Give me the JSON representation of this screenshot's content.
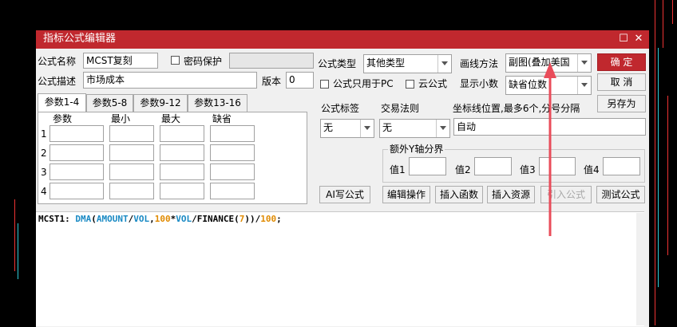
{
  "window": {
    "title": "指标公式编辑器"
  },
  "fields": {
    "name_label": "公式名称",
    "name_value": "MCST复刻",
    "password_label": "密码保护",
    "desc_label": "公式描述",
    "desc_value": "市场成本",
    "version_label": "版本",
    "version_value": "0",
    "type_label": "公式类型",
    "type_value": "其他类型",
    "pc_only_label": "公式只用于PC",
    "cloud_label": "云公式",
    "draw_label": "画线方法",
    "draw_value": "副图(叠加美国",
    "decimal_label": "显示小数",
    "decimal_value": "缺省位数"
  },
  "buttons": {
    "ok": "确 定",
    "cancel": "取 消",
    "save_as": "另存为",
    "ai": "AI写公式",
    "edit_ops": "编辑操作",
    "insert_func": "插入函数",
    "insert_resource": "插入资源",
    "import_formula": "引入公式",
    "test_formula": "测试公式"
  },
  "tabs": [
    "参数1-4",
    "参数5-8",
    "参数9-12",
    "参数13-16"
  ],
  "params": {
    "headers": [
      "参数",
      "最小",
      "最大",
      "缺省"
    ],
    "rows": [
      "1",
      "2",
      "3",
      "4"
    ]
  },
  "labels": {
    "formula_tag": "公式标签",
    "formula_tag_value": "无",
    "trade_rule": "交易法则",
    "trade_rule_value": "无",
    "axis_pos": "坐标线位置,最多6个,分号分隔",
    "axis_pos_value": "自动",
    "extra_y": "额外Y轴分界",
    "val1": "值1",
    "val2": "值2",
    "val3": "值3",
    "val4": "值4"
  },
  "code": {
    "name": "MCST1: ",
    "tokens": [
      {
        "t": "DMA",
        "c": "#1a8ac4"
      },
      {
        "t": "(",
        "c": "#000000"
      },
      {
        "t": "AMOUNT",
        "c": "#1a8ac4"
      },
      {
        "t": "/",
        "c": "#000000"
      },
      {
        "t": "VOL",
        "c": "#1a8ac4"
      },
      {
        "t": ",",
        "c": "#000000"
      },
      {
        "t": "100",
        "c": "#e08a00"
      },
      {
        "t": "*",
        "c": "#000000"
      },
      {
        "t": "VOL",
        "c": "#1a8ac4"
      },
      {
        "t": "/FINANCE(",
        "c": "#000000"
      },
      {
        "t": "7",
        "c": "#e08a00"
      },
      {
        "t": "))/",
        "c": "#000000"
      },
      {
        "t": "100",
        "c": "#e08a00"
      },
      {
        "t": ";",
        "c": "#000000"
      }
    ]
  },
  "colors": {
    "title_bar": "#c0282e",
    "keyword": "#1a8ac4",
    "number": "#e08a00",
    "arrow": "#e94c5a"
  }
}
